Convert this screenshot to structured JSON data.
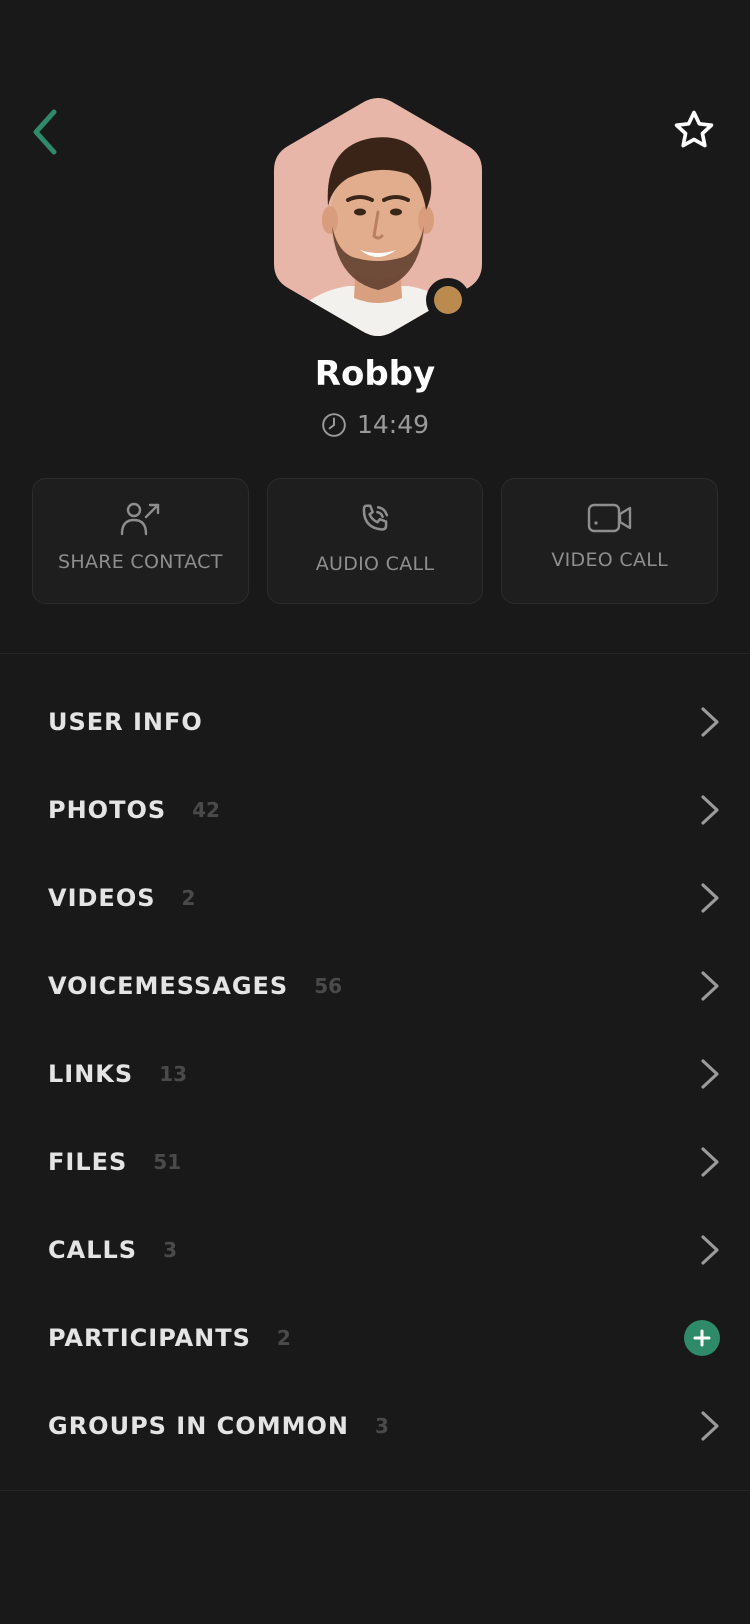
{
  "contact": {
    "name": "Robby",
    "last_seen": "14:49",
    "status_color": "#bb8a4f",
    "avatar_background": "#e8b6a8"
  },
  "header": {
    "back_icon": "chevron-left-icon",
    "favorite_icon": "star-outline-icon",
    "accent_color": "#2f8a6a"
  },
  "actions": [
    {
      "label": "SHARE CONTACT",
      "icon": "share-contact-icon"
    },
    {
      "label": "AUDIO CALL",
      "icon": "phone-icon"
    },
    {
      "label": "VIDEO CALL",
      "icon": "video-camera-icon"
    }
  ],
  "menu": [
    {
      "label": "USER INFO",
      "count": "",
      "action": "chevron-right-icon"
    },
    {
      "label": "PHOTOS",
      "count": "42",
      "action": "chevron-right-icon"
    },
    {
      "label": "VIDEOS",
      "count": "2",
      "action": "chevron-right-icon"
    },
    {
      "label": "VOICEMESSAGES",
      "count": "56",
      "action": "chevron-right-icon"
    },
    {
      "label": "LINKS",
      "count": "13",
      "action": "chevron-right-icon"
    },
    {
      "label": "FILES",
      "count": "51",
      "action": "chevron-right-icon"
    },
    {
      "label": "CALLS",
      "count": "3",
      "action": "chevron-right-icon"
    },
    {
      "label": "PARTICIPANTS",
      "count": "2",
      "action": "plus-icon"
    },
    {
      "label": "GROUPS IN COMMON",
      "count": "3",
      "action": "chevron-right-icon"
    }
  ]
}
